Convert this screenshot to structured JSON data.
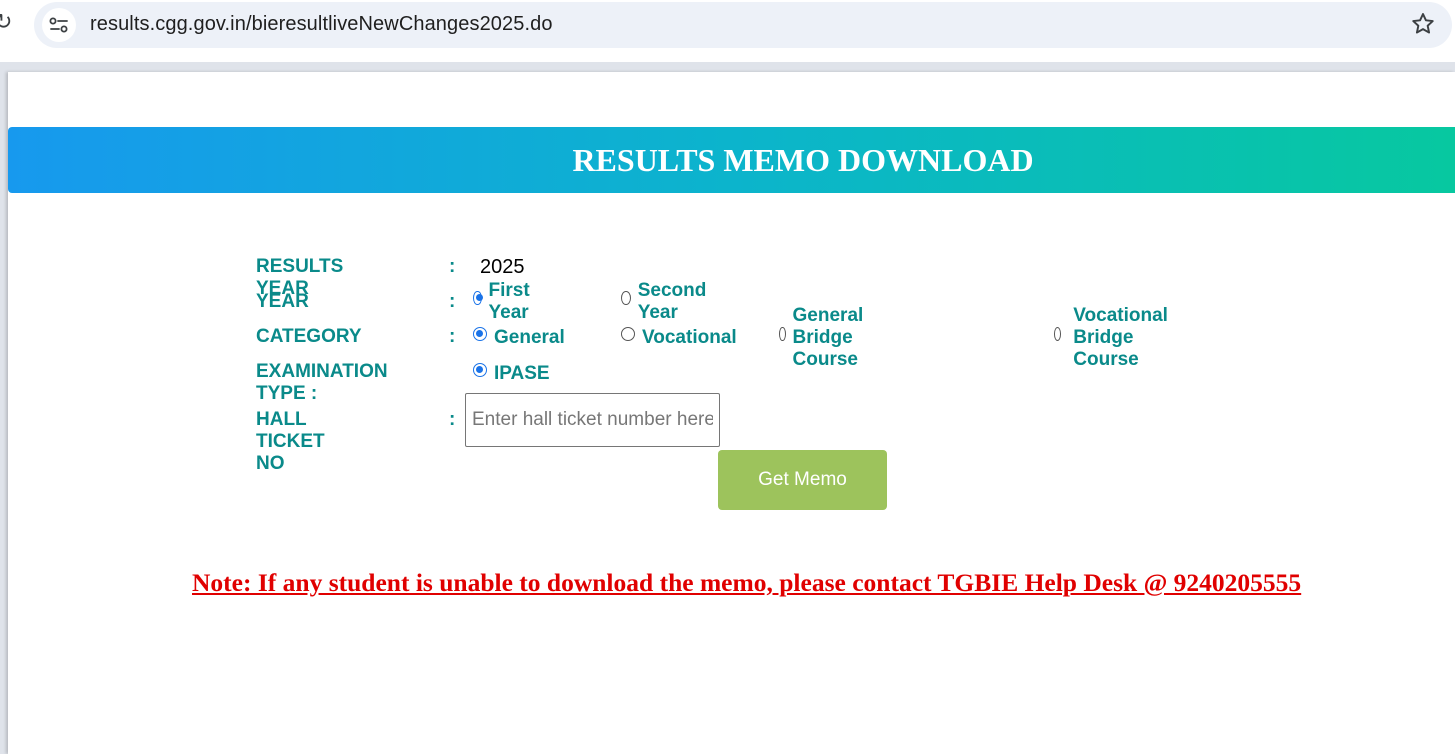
{
  "browser": {
    "url": "results.cgg.gov.in/bieresultliveNewChanges2025.do",
    "site_info_icon": "tune-icon",
    "bookmark_icon": "star-icon"
  },
  "banner": {
    "title": "RESULTS MEMO DOWNLOAD"
  },
  "form": {
    "separator": ":",
    "results_year": {
      "label": "RESULTS YEAR",
      "value": "2025"
    },
    "year": {
      "label": "YEAR",
      "options": [
        {
          "label": "First Year",
          "checked": true
        },
        {
          "label": "Second Year",
          "checked": false
        }
      ]
    },
    "category": {
      "label": "CATEGORY",
      "options": [
        {
          "label": "General",
          "checked": true
        },
        {
          "label": "Vocational",
          "checked": false
        },
        {
          "label": "General Bridge Course",
          "checked": false
        },
        {
          "label": "Vocational Bridge Course",
          "checked": false
        }
      ]
    },
    "exam_type": {
      "label": "EXAMINATION TYPE :",
      "options": [
        {
          "label": "IPASE",
          "checked": true
        }
      ]
    },
    "hall_ticket": {
      "label": "HALL TICKET NO",
      "value": "",
      "placeholder": "Enter hall ticket number here"
    },
    "submit_label": "Get Memo"
  },
  "note": "Note: If any student is unable to download the memo, please contact TGBIE Help Desk @ 9240205555",
  "colors": {
    "label": "#0a8a8a",
    "banner_start": "#1799ee",
    "banner_end": "#07c8a0",
    "button": "#9dc35c",
    "note": "#e00000",
    "radio_checked": "#1a73e8"
  }
}
